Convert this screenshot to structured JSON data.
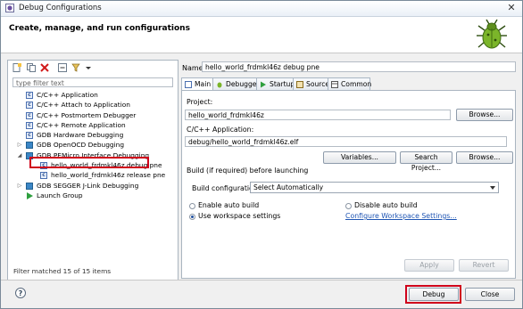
{
  "window": {
    "title": "Debug Configurations",
    "close_glyph": "✕"
  },
  "header": {
    "title": "Create, manage, and run configurations"
  },
  "left": {
    "filter_placeholder": "type filter text",
    "tree": [
      {
        "label": "C/C++ Application",
        "icon": "c-config-icon",
        "indent": 1
      },
      {
        "label": "C/C++ Attach to Application",
        "icon": "c-config-icon",
        "indent": 1
      },
      {
        "label": "C/C++ Postmortem Debugger",
        "icon": "c-config-icon",
        "indent": 1
      },
      {
        "label": "C/C++ Remote Application",
        "icon": "c-config-icon",
        "indent": 1
      },
      {
        "label": "GDB Hardware Debugging",
        "icon": "c-config-icon",
        "indent": 1
      },
      {
        "label": "GDB OpenOCD Debugging",
        "icon": "gdb-icon",
        "indent": 1,
        "twisty": "▷"
      },
      {
        "label": "GDB PEMicro Interface Debugging",
        "icon": "gdb-icon",
        "indent": 1,
        "twisty": "◢"
      },
      {
        "label": "hello_world_frdmkl46z debug pne",
        "icon": "c-config-icon",
        "indent": 2,
        "selected": true
      },
      {
        "label": "hello_world_frdmkl46z release pne",
        "icon": "c-config-icon",
        "indent": 2
      },
      {
        "label": "GDB SEGGER J-Link Debugging",
        "icon": "gdb-icon",
        "indent": 1,
        "twisty": "▷"
      },
      {
        "label": "Launch Group",
        "icon": "launch-group-icon",
        "indent": 1
      }
    ],
    "status": "Filter matched 15 of 15 items"
  },
  "config": {
    "name_label": "Name:",
    "name_value": "hello_world_frdmkl46z debug pne",
    "tabs": [
      "Main",
      "Debugger",
      "Startup",
      "Source",
      "Common"
    ],
    "project_label": "Project:",
    "project_value": "hello_world_frdmkl46z",
    "browse_label": "Browse...",
    "app_label": "C/C++ Application:",
    "app_value": "debug/hello_world_frdmkl46z.elf",
    "variables_label": "Variables...",
    "search_label": "Search Project...",
    "browse2_label": "Browse...",
    "build_section": "Build (if required) before launching",
    "build_config_label": "Build configuration:",
    "build_config_value": "Select Automatically",
    "enable_auto": "Enable auto build",
    "disable_auto": "Disable auto build",
    "use_workspace": "Use workspace settings",
    "configure_link": "Configure Workspace Settings...",
    "apply_label": "Apply",
    "revert_label": "Revert"
  },
  "footer": {
    "help": "?",
    "debug_label": "Debug",
    "close_label": "Close"
  }
}
